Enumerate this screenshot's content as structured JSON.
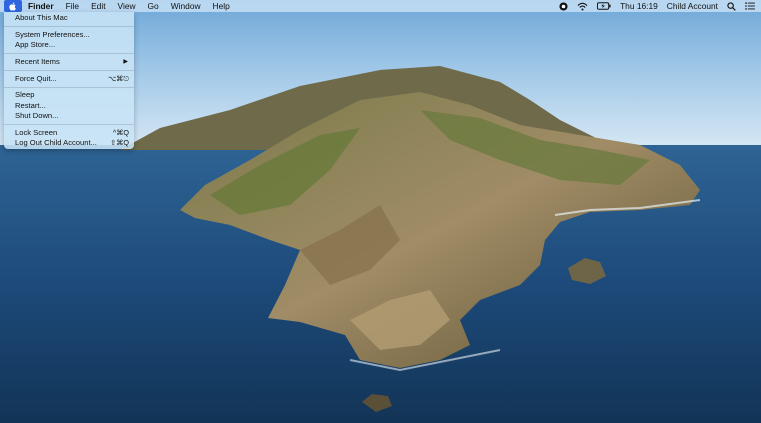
{
  "menubar": {
    "app_name": "Finder",
    "menus": [
      "File",
      "Edit",
      "View",
      "Go",
      "Window",
      "Help"
    ],
    "clock": "Thu 16:19",
    "user": "Child Account",
    "icons": [
      "screen-record-icon",
      "wifi-icon",
      "battery-icon",
      "search-icon",
      "notification-center-icon"
    ]
  },
  "apple_menu": {
    "about": "About This Mac",
    "system_prefs": "System Preferences...",
    "app_store": "App Store...",
    "recent_items": "Recent Items",
    "force_quit": "Force Quit...",
    "force_quit_shortcut": "⌥⌘⎋",
    "sleep": "Sleep",
    "restart": "Restart...",
    "shut_down": "Shut Down...",
    "lock_screen": "Lock Screen",
    "lock_screen_shortcut": "^⌘Q",
    "log_out": "Log Out Child Account...",
    "log_out_shortcut": "⇧⌘Q"
  },
  "colors": {
    "menu_highlight": "#2f66e0",
    "sky": "#8fc0e6",
    "ocean": "#1d4b7a"
  }
}
